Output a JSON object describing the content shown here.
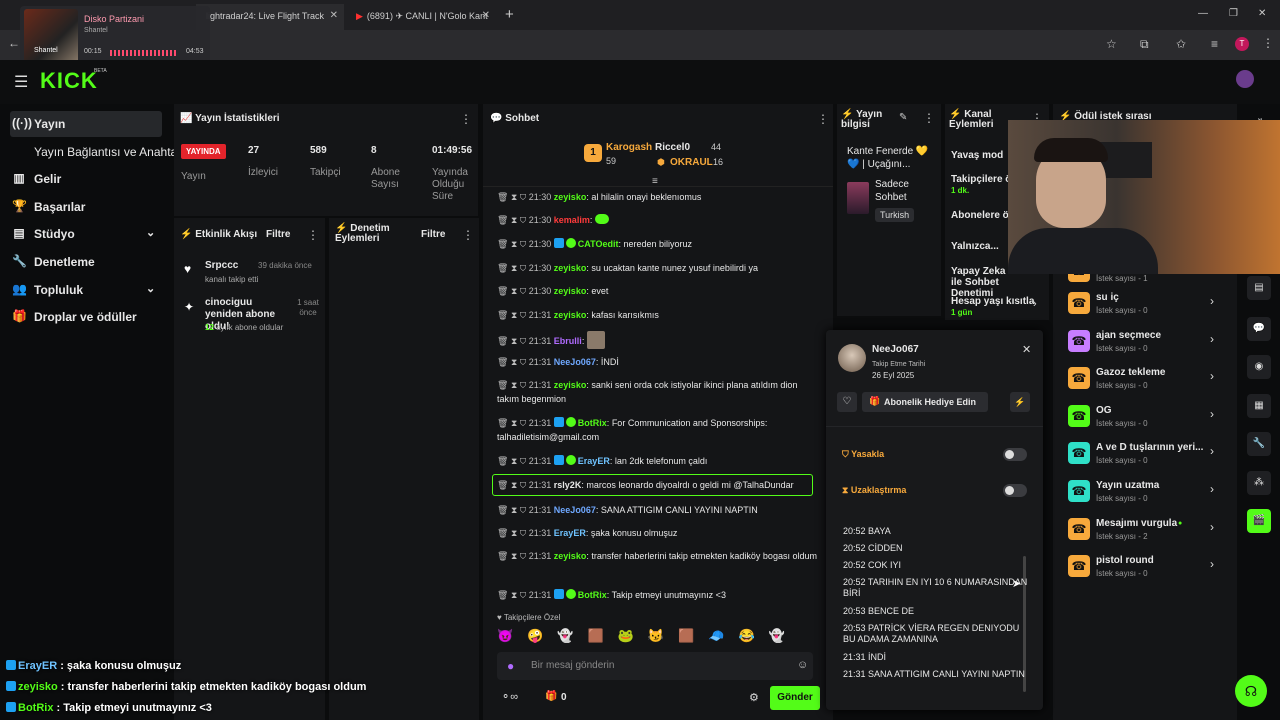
{
  "browser": {
    "tabs": [
      {
        "label": "lightradar24: Live Flight Track"
      },
      {
        "label": "(6891) ✈ CANLI | N'Golo Kant"
      }
    ],
    "new_tab": "+",
    "address": "m",
    "window": {
      "minimize": "—",
      "restore": "❐",
      "close": "✕"
    }
  },
  "media": {
    "title": "Disko Partizani",
    "artist": "Shantel",
    "elapsed": "00:15",
    "duration": "04:53",
    "progress": 0.05,
    "art_label": "Shantel"
  },
  "kick": {
    "logo": "KICK",
    "beta": "BETA"
  },
  "sidebar": {
    "items": [
      {
        "label": "Yayın",
        "icon": "broadcast-icon"
      },
      {
        "label": "Yayın Bağlantısı ve Anahtarı",
        "icon": ""
      },
      {
        "label": "Gelir",
        "icon": "chart-icon"
      },
      {
        "label": "Başarılar",
        "icon": "trophy-icon"
      },
      {
        "label": "Stüdyo",
        "icon": "studio-icon"
      },
      {
        "label": "Denetleme",
        "icon": "wrench-icon"
      },
      {
        "label": "Topluluk",
        "icon": "community-icon"
      },
      {
        "label": "Droplar ve ödüller",
        "icon": "gift-icon"
      }
    ]
  },
  "stats": {
    "title": "Yayın İstatistikleri",
    "live_badge": "YAYINDA",
    "live_label": "Yayın",
    "viewers": "27",
    "viewers_label": "İzleyici",
    "followers": "589",
    "followers_label": "Takipçi",
    "subs": "8",
    "subs_label": "Abone Sayısı",
    "uptime": "01:49:56",
    "uptime_label": "Yayında Olduğu Süre"
  },
  "activity": {
    "title": "Etkinlik Akışı",
    "filter": "Filtre",
    "items": [
      {
        "name": "Srpccc",
        "time": "39 dakika önce",
        "desc": "kanalı takip etti"
      },
      {
        "name": "cinociguu yeniden abone oldu!",
        "time": "1 saat önce",
        "count": "12",
        "desc": "aylık abone oldular"
      }
    ]
  },
  "moderation": {
    "title": "Denetim Eylemleri",
    "filter": "Filtre"
  },
  "chat": {
    "title": "Sohbet",
    "top1": {
      "name": "Karogash",
      "count": "59"
    },
    "top2": {
      "name": "Riccel0",
      "count": "44"
    },
    "top3": {
      "name": "OKRAUL",
      "count": "16"
    },
    "lines": [
      {
        "time": "21:30",
        "user": "zeyisko",
        "color": "#53fc18",
        "text": "al hilalin onayi beklenıomus"
      },
      {
        "time": "21:30",
        "user": "kemalim",
        "color": "#ff3b3b",
        "text": ""
      },
      {
        "time": "21:30",
        "user": "CATOedit",
        "color": "#53fc18",
        "text": "nereden biliyoruz"
      },
      {
        "time": "21:30",
        "user": "zeyisko",
        "color": "#53fc18",
        "text": "su ucaktan kante nunez yusuf inebilirdi ya"
      },
      {
        "time": "21:30",
        "user": "zeyisko",
        "color": "#53fc18",
        "text": "evet"
      },
      {
        "time": "21:31",
        "user": "zeyisko",
        "color": "#53fc18",
        "text": "kafası karısıkmıs"
      },
      {
        "time": "21:31",
        "user": "Ebrulli",
        "color": "#b06bff",
        "text": ""
      },
      {
        "time": "21:31",
        "user": "NeeJo067",
        "color": "#6fa8ff",
        "text": "İNDİ"
      },
      {
        "time": "21:31",
        "user": "zeyisko",
        "color": "#53fc18",
        "text": "sanki seni orda cok istiyolar ikinci plana atıldım dion takım begenmion"
      },
      {
        "time": "21:31",
        "user": "BotRix",
        "color": "#53fc18",
        "text": "For Communication and Sponsorships: talhadiletisim@gmail.com"
      },
      {
        "time": "21:31",
        "user": "ErayER",
        "color": "#6fc3ff",
        "text": "lan 2dk telefonum çaldı"
      },
      {
        "time": "21:31",
        "user": "rsly2K",
        "color": "#e8e8e8",
        "text": "marcos leonardo diyoalrdı o geldi mi @TalhaDundar"
      },
      {
        "time": "21:31",
        "user": "NeeJo067",
        "color": "#6fa8ff",
        "text": "SANA ATTIGIM CANLI YAYINI NAPTIN"
      },
      {
        "time": "21:31",
        "user": "ErayER",
        "color": "#6fc3ff",
        "text": "şaka konusu olmuşuz"
      },
      {
        "time": "21:31",
        "user": "zeyisko",
        "color": "#53fc18",
        "text": "transfer haberlerini takip etmekten kadiköy bogası oldum"
      },
      {
        "time": "21:31",
        "user": "BotRix",
        "color": "#53fc18",
        "text": "Takip etmeyi unutmayınız <3"
      }
    ],
    "followers_only": "Takipçilere Özel",
    "placeholder": "Bir mesaj gönderin",
    "send": "Gönder",
    "points": "0"
  },
  "stream_info": {
    "title": "Yayın bilgisi",
    "stream_title": "Kante Fenerde 💛💙 | Uçağını...",
    "category": "Sadece Sohbet",
    "language": "Turkish"
  },
  "channel_actions": {
    "title": "Kanal Eylemleri",
    "items": [
      {
        "label": "Yavaş mod",
        "sub": ""
      },
      {
        "label": "Takipçilere ö",
        "sub": "1 dk."
      },
      {
        "label": "Abonelere öz",
        "sub": ""
      },
      {
        "label": "Yalnızca...",
        "sub": ""
      },
      {
        "label": "Yapay Zeka ile Sohbet Denetimi",
        "sub": ""
      },
      {
        "label": "Hesap yaşı kısıtla",
        "sub": "1 gün"
      }
    ]
  },
  "rewards": {
    "title": "Ödül istek sırası",
    "items": [
      {
        "name": "",
        "sub": "İstek sayısı - 1",
        "color": "#f7a93c"
      },
      {
        "name": "su iç",
        "sub": "İstek sayısı - 0",
        "color": "#f7a93c"
      },
      {
        "name": "ajan seçmece",
        "sub": "İstek sayısı - 0",
        "color": "#c77dff"
      },
      {
        "name": "Gazoz tekleme",
        "sub": "İstek sayısı - 0",
        "color": "#f7a93c"
      },
      {
        "name": "OG",
        "sub": "İstek sayısı - 0",
        "color": "#53fc18"
      },
      {
        "name": "A ve D tuşlarının yeri...",
        "sub": "İstek sayısı - 0",
        "color": "#2fe0c8"
      },
      {
        "name": "Yayın uzatma",
        "sub": "İstek sayısı - 0",
        "color": "#2fe0c8"
      },
      {
        "name": "Mesajımı vurgula",
        "sub": "İstek sayısı - 2",
        "color": "#f7a93c"
      },
      {
        "name": "pistol round",
        "sub": "İstek sayısı - 0",
        "color": "#f7a93c"
      }
    ]
  },
  "user_card": {
    "username": "NeeJo067",
    "follow_label": "Takip Etme Tarihi",
    "follow_date": "26 Eyl 2025",
    "gift_button": "Abonelik Hediye Edin",
    "ban": "Yasakla",
    "timeout": "Uzaklaştırma",
    "messages": [
      {
        "time": "20:52",
        "text": "BAYA"
      },
      {
        "time": "20:52",
        "text": "CİDDEN"
      },
      {
        "time": "20:52",
        "text": "COK IYI"
      },
      {
        "time": "20:52",
        "text": "TARIHIN EN IYI 10 6 NUMARASINDAN BİRİ"
      },
      {
        "time": "20:53",
        "text": "BENCE DE"
      },
      {
        "time": "20:53",
        "text": "PATRİCK VİERA REGEN DENIYODU BU ADAMA ZAMANINA"
      },
      {
        "time": "21:31",
        "text": "İNDİ"
      },
      {
        "time": "21:31",
        "text": "SANA ATTIGIM CANLI YAYINI NAPTIN"
      }
    ]
  },
  "overlay_chat": [
    {
      "user": "ErayER",
      "color": "#6fc3ff",
      "text": "şaka konusu olmuşuz"
    },
    {
      "user": "zeyisko",
      "color": "#53fc18",
      "text": "transfer haberlerini takip etmekten kadiköy bogası oldum"
    },
    {
      "user": "BotRix",
      "color": "#53fc18",
      "text": "Takip etmeyi unutmayınız <3"
    }
  ],
  "colors": {
    "brand": "#53fc18",
    "live": "#e3242b",
    "panel": "#141517"
  }
}
